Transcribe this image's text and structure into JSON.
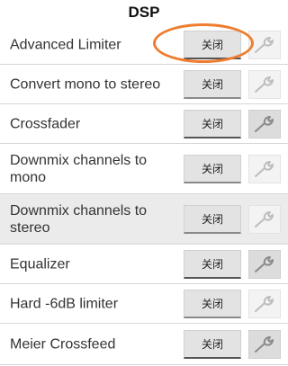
{
  "header": {
    "title": "DSP"
  },
  "toggle_label": "关闭",
  "colors": {
    "highlight": "#ee7d2e",
    "row_shaded": "#ebebeb",
    "divider": "#d6d6d6"
  },
  "rows": [
    {
      "label": "Advanced Limiter",
      "toggle": "关闭",
      "settings_icon": "wrench-icon",
      "settings_enabled": false
    },
    {
      "label": "Convert mono to stereo",
      "toggle": "关闭",
      "settings_icon": "wrench-icon",
      "settings_enabled": false
    },
    {
      "label": "Crossfader",
      "toggle": "关闭",
      "settings_icon": "wrench-icon",
      "settings_enabled": true
    },
    {
      "label": "Downmix channels to mono",
      "toggle": "关闭",
      "settings_icon": "wrench-icon",
      "settings_enabled": false
    },
    {
      "label": "Downmix channels to stereo",
      "toggle": "关闭",
      "settings_icon": "wrench-icon",
      "settings_enabled": false
    },
    {
      "label": "Equalizer",
      "toggle": "关闭",
      "settings_icon": "wrench-icon",
      "settings_enabled": true
    },
    {
      "label": "Hard -6dB limiter",
      "toggle": "关闭",
      "settings_icon": "wrench-icon",
      "settings_enabled": false
    },
    {
      "label": "Meier Crossfeed",
      "toggle": "关闭",
      "settings_icon": "wrench-icon",
      "settings_enabled": true
    }
  ]
}
